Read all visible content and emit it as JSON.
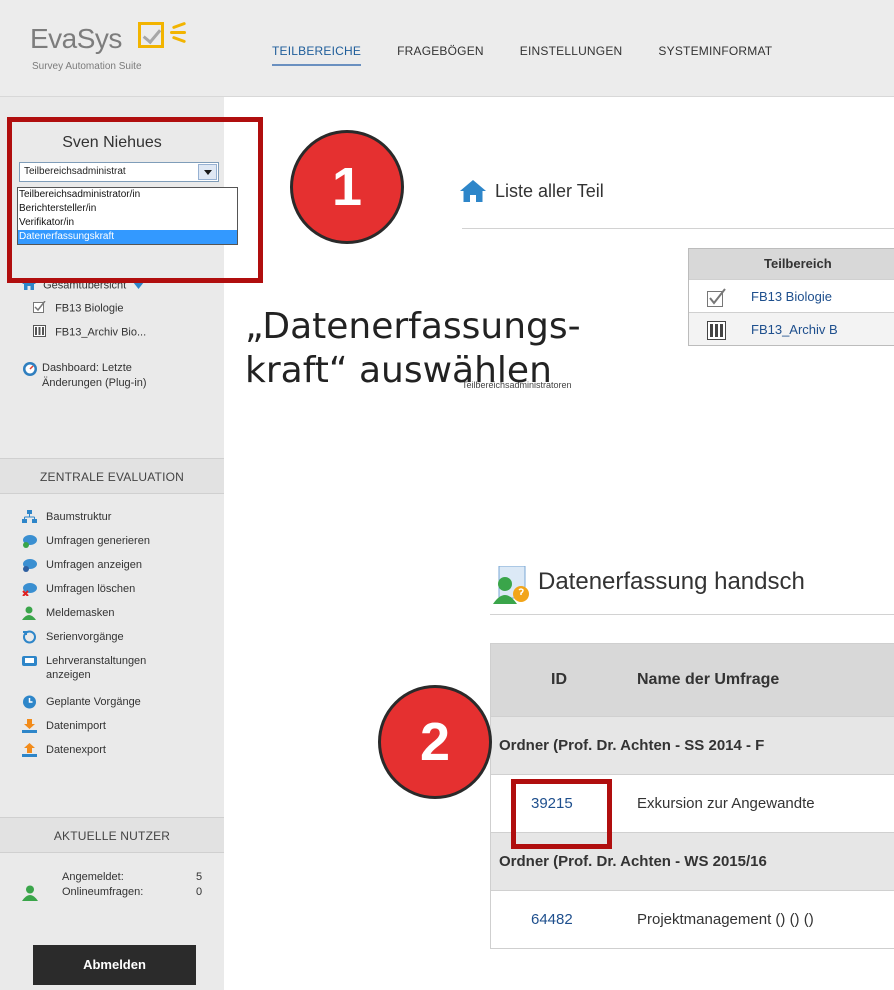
{
  "app": {
    "name": "EvaSys",
    "tagline": "Survey Automation Suite",
    "accent": "#f2b400",
    "nav": [
      {
        "label": "TEILBEREICHE",
        "active": true
      },
      {
        "label": "FRAGEBÖGEN",
        "active": false
      },
      {
        "label": "EINSTELLUNGEN",
        "active": false
      },
      {
        "label": "SYSTEMINFORMAT",
        "active": false
      }
    ]
  },
  "sidebar": {
    "user_name": "Sven Niehues",
    "role_select": {
      "value": "Teilbereichsadministrat",
      "options": [
        {
          "label": "Teilbereichsadministrator/in",
          "selected": false
        },
        {
          "label": "Berichtersteller/in",
          "selected": false
        },
        {
          "label": "Verifikator/in",
          "selected": false
        },
        {
          "label": "Datenerfassungskraft",
          "selected": true
        }
      ]
    },
    "tree": {
      "overview": "Gesamtübersicht",
      "items": [
        "FB13 Biologie",
        "FB13_Archiv Bio..."
      ]
    },
    "dashboard": {
      "line1": "Dashboard: Letzte",
      "line2": "Änderungen (Plug-in)"
    },
    "section_central": "ZENTRALE EVALUATION",
    "menu": [
      {
        "label": "Baumstruktur",
        "icon": "tree-structure-icon"
      },
      {
        "label": "Umfragen generieren",
        "icon": "generate-surveys-icon"
      },
      {
        "label": "Umfragen anzeigen",
        "icon": "show-surveys-icon"
      },
      {
        "label": "Umfragen löschen",
        "icon": "delete-surveys-icon"
      },
      {
        "label": "Meldemasken",
        "icon": "user-form-icon"
      },
      {
        "label": "Serienvorgänge",
        "icon": "series-process-icon"
      },
      {
        "label": "Lehrveranstaltungen",
        "label2": "anzeigen",
        "icon": "courses-icon"
      },
      {
        "label": "Geplante Vorgänge",
        "icon": "scheduled-icon"
      },
      {
        "label": "Datenimport",
        "icon": "import-icon"
      },
      {
        "label": "Datenexport",
        "icon": "export-icon"
      }
    ],
    "section_users": "AKTUELLE NUTZER",
    "users": {
      "logged_in_label": "Angemeldet:",
      "logged_in_value": "5",
      "online_label": "Onlineumfragen:",
      "online_value": "0"
    },
    "logout_label": "Abmelden"
  },
  "main": {
    "section1": {
      "title": "Liste aller Teil",
      "header": "Teilbereich",
      "rows": [
        "FB13 Biologie",
        "FB13_Archiv B"
      ],
      "footnote": "Teilbereichsadministratoren"
    },
    "section2": {
      "title": "Datenerfassung handsch",
      "headers": {
        "id": "ID",
        "name": "Name der Umfrage"
      },
      "groups": [
        {
          "folder": "Ordner (Prof. Dr. Achten - SS 2014 - F",
          "rows": [
            {
              "id": "39215",
              "name": "Exkursion zur Angewandte"
            }
          ]
        },
        {
          "folder": "Ordner (Prof. Dr. Achten - WS 2015/16",
          "rows": [
            {
              "id": "64482",
              "name": "Projektmanagement () () ()"
            }
          ]
        }
      ]
    }
  },
  "annotations": {
    "step1": "1",
    "step2": "2",
    "text_line1": "„Datenerfassungs-",
    "text_line2": "kraft“ auswählen",
    "color": "#e53030"
  }
}
